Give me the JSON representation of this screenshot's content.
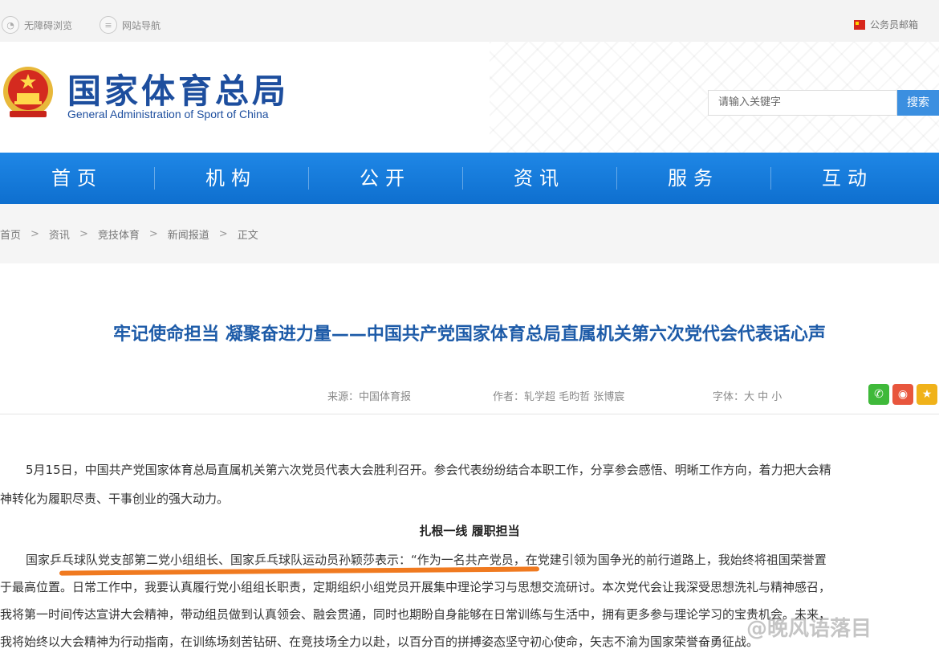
{
  "topbar": {
    "accessibility": "无障碍浏览",
    "site_nav": "网站导航",
    "mail": "公务员邮箱"
  },
  "header": {
    "brand_cn": "国家体育总局",
    "brand_en": "General Administration of Sport of China",
    "search_placeholder": "请输入关键字",
    "search_button": "搜索"
  },
  "nav": [
    "首页",
    "机构",
    "公开",
    "资讯",
    "服务",
    "互动"
  ],
  "breadcrumb": [
    "首页",
    "资讯",
    "竞技体育",
    "新闻报道",
    "正文"
  ],
  "breadcrumb_sep": ">",
  "article": {
    "title": "牢记使命担当 凝聚奋进力量——中国共产党国家体育总局直属机关第六次党代会代表话心声",
    "source": "来源：中国体育报",
    "author": "作者：轧学超 毛昀哲 张博宸",
    "font_label": "字体：大 中 小",
    "para1_line1": "5月15日，中国共产党国家体育总局直属机关第六次党员代表大会胜利召开。参会代表纷纷结合本职工作，分享参会感悟、明晰工作方向，着力把大会精",
    "para1_line2": "神转化为履职尽责、干事创业的强大动力。",
    "subheading": "扎根一线 履职担当",
    "para2_line1": "国家乒乓球队党支部第二党小组组长、国家乒乓球队运动员孙颖莎表示：“作为一名共产党员，在党建引领为国争光的前行道路上，我始终将祖国荣誉置",
    "para2_line2": "于最高位置。日常工作中，我要认真履行党小组组长职责，定期组织小组党员开展集中理论学习与思想交流研讨。本次党代会让我深受思想洗礼与精神感召，",
    "para2_line3": "我将第一时间传达宣讲大会精神，带动组员做到认真领会、融会贯通，同时也期盼自身能够在日常训练与生活中，拥有更多参与理论学习的宝贵机会。未来，",
    "para2_line4": "我将始终以大会精神为行动指南，在训练场刻苦钻研、在竞技场全力以赴，以百分百的拼搏姿态坚守初心使命，矢志不渝为国家荣誉奋勇征战。"
  },
  "watermark": "@晚风语落目",
  "colors": {
    "brand_blue": "#1d4e9e",
    "nav_blue": "#1479dc",
    "title_blue": "#1d5ba8",
    "highlight": "#f07a20"
  }
}
